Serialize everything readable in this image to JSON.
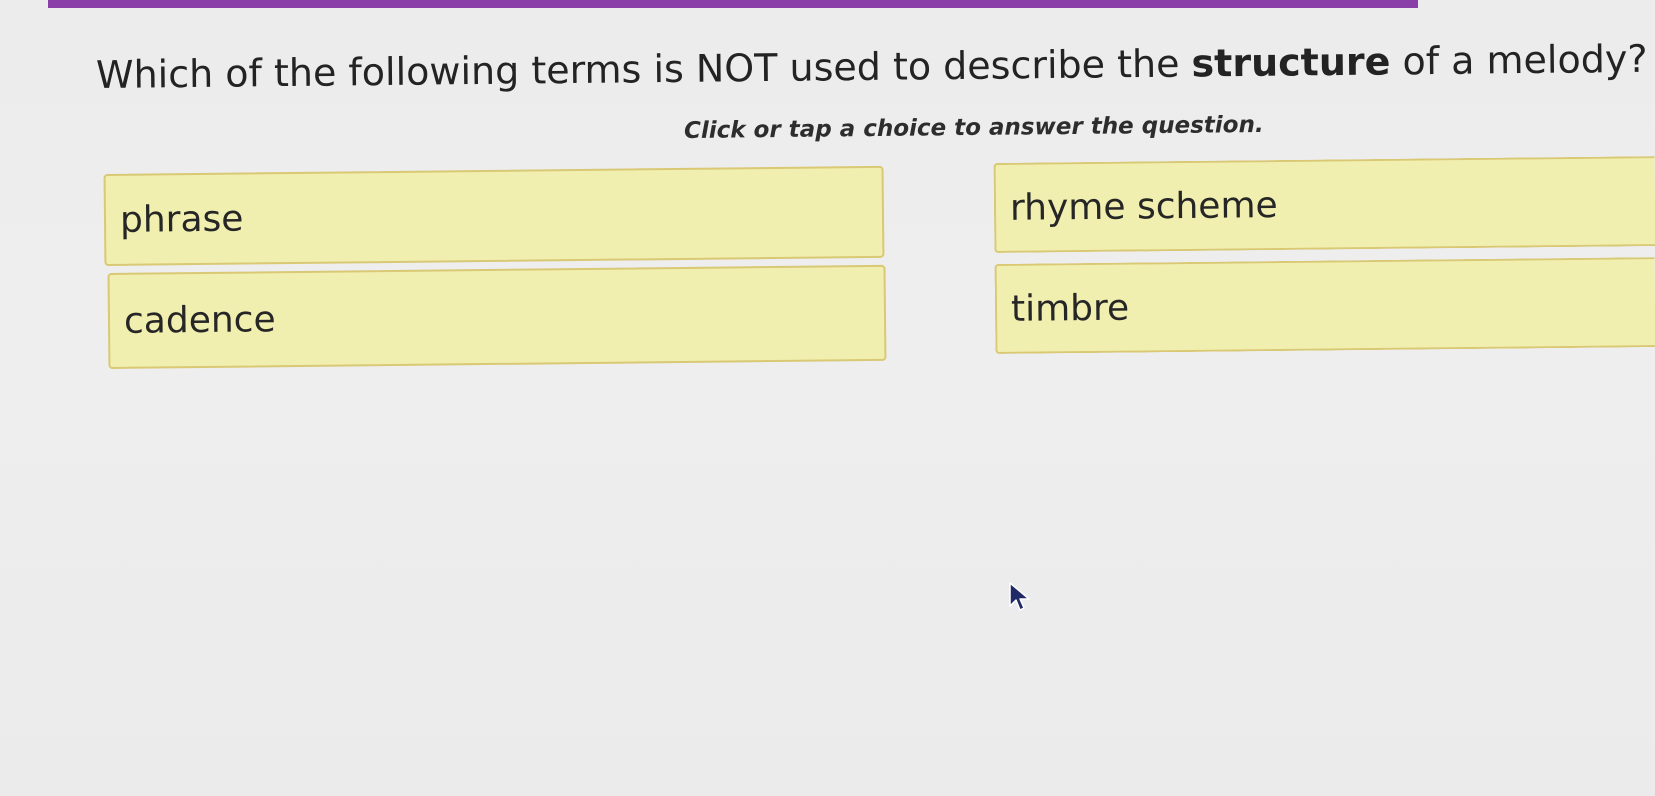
{
  "question": {
    "text_before": "Which of the following terms is NOT used to describe the ",
    "text_bold": "structure",
    "text_after": " of a melody?"
  },
  "instruction": "Click or tap a choice to answer the question.",
  "choices": [
    {
      "label": "phrase"
    },
    {
      "label": "rhyme scheme"
    },
    {
      "label": "cadence"
    },
    {
      "label": "timbre"
    }
  ],
  "colors": {
    "accent_bar": "#8a3fa8",
    "choice_fill": "#f1efaf",
    "choice_border": "#d9c874"
  }
}
